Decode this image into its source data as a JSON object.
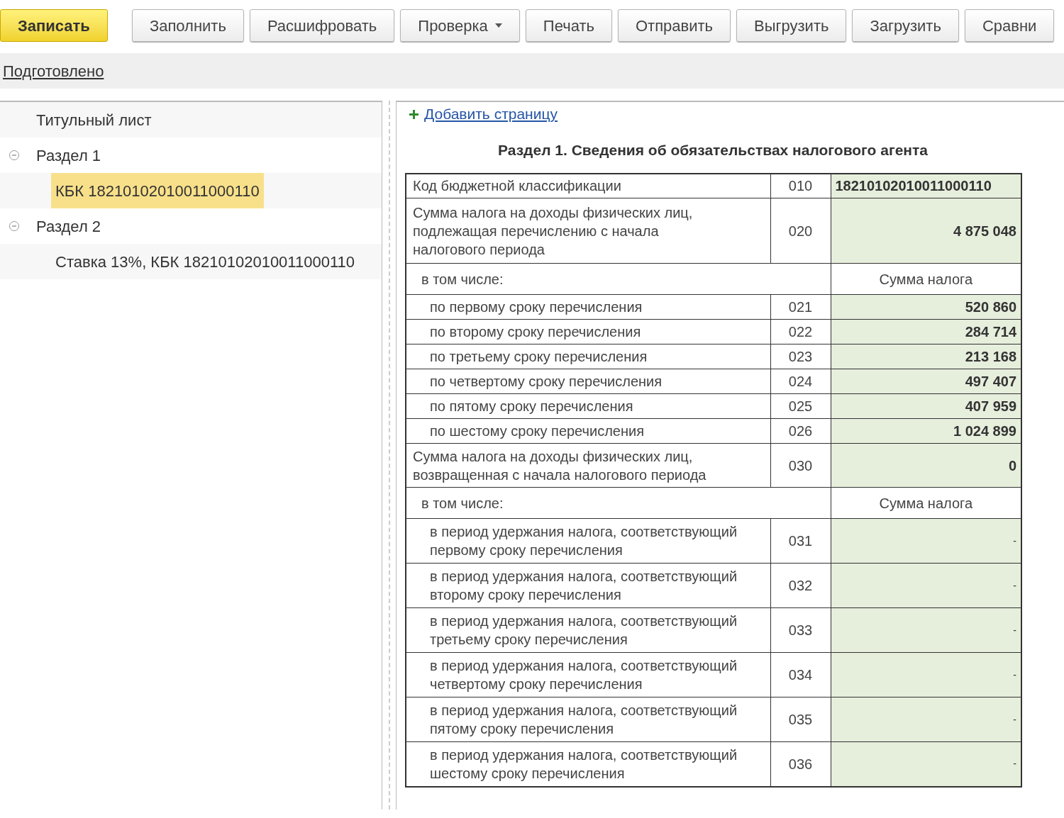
{
  "toolbar": [
    {
      "label": "Записать",
      "kind": "primary"
    },
    {
      "label": "Заполнить",
      "kind": "plain"
    },
    {
      "label": "Расшифровать",
      "kind": "plain"
    },
    {
      "label": "Проверка",
      "kind": "dropdown"
    },
    {
      "label": "Печать",
      "kind": "plain"
    },
    {
      "label": "Отправить",
      "kind": "plain"
    },
    {
      "label": "Выгрузить",
      "kind": "plain"
    },
    {
      "label": "Загрузить",
      "kind": "plain"
    },
    {
      "label": "Сравни",
      "kind": "plain"
    }
  ],
  "status_link": "Подготовлено",
  "tree": [
    {
      "label": "Титульный лист",
      "selected": false
    },
    {
      "label": "Раздел 1",
      "expanded": true,
      "selected": false,
      "children": [
        {
          "label": "КБК 18210102010011000110",
          "selected": true
        }
      ]
    },
    {
      "label": "Раздел 2",
      "expanded": true,
      "selected": false,
      "children": [
        {
          "label": "Ставка 13%, КБК 18210102010011000110",
          "selected": false
        }
      ]
    }
  ],
  "add_page_link": "Добавить страницу",
  "section_title": "Раздел 1. Сведения об обязательствах налогового агента",
  "rows": [
    {
      "kind": "code",
      "label": "Код бюджетной классификации",
      "code": "010",
      "value": "18210102010011000110"
    },
    {
      "kind": "field",
      "label": "Сумма налога на доходы физических лиц, подлежащая перечислению с начала налогового периода",
      "code": "020",
      "value": "4 875 048"
    },
    {
      "kind": "header",
      "label": "в том числе:",
      "value": "Сумма налога"
    },
    {
      "kind": "sub",
      "label": "по первому сроку перечисления",
      "code": "021",
      "value": "520 860"
    },
    {
      "kind": "sub",
      "label": "по второму сроку перечисления",
      "code": "022",
      "value": "284 714"
    },
    {
      "kind": "sub",
      "label": "по третьему сроку перечисления",
      "code": "023",
      "value": "213 168"
    },
    {
      "kind": "sub",
      "label": "по четвертому сроку перечисления",
      "code": "024",
      "value": "497 407"
    },
    {
      "kind": "sub",
      "label": "по пятому сроку перечисления",
      "code": "025",
      "value": "407 959"
    },
    {
      "kind": "sub",
      "label": "по шестому сроку перечисления",
      "code": "026",
      "value": "1 024 899"
    },
    {
      "kind": "field",
      "label": "Сумма налога на доходы физических лиц, возвращенная с начала налогового периода",
      "code": "030",
      "value": "0"
    },
    {
      "kind": "header",
      "label": "в том числе:",
      "value": "Сумма налога"
    },
    {
      "kind": "sub2",
      "label": "в период удержания налога, соответствующий первому сроку перечисления",
      "code": "031",
      "value": "-"
    },
    {
      "kind": "sub2",
      "label": "в период удержания налога, соответствующий второму сроку перечисления",
      "code": "032",
      "value": "-"
    },
    {
      "kind": "sub2",
      "label": "в период удержания налога, соответствующий третьему сроку перечисления",
      "code": "033",
      "value": "-"
    },
    {
      "kind": "sub2",
      "label": "в период удержания налога, соответствующий четвертому сроку перечисления",
      "code": "034",
      "value": "-"
    },
    {
      "kind": "sub2",
      "label": "в период удержания налога, соответствующий пятому сроку перечисления",
      "code": "035",
      "value": "-"
    },
    {
      "kind": "sub2",
      "label": "в период удержания налога, соответствующий шестому сроку перечисления",
      "code": "036",
      "value": "-"
    }
  ]
}
